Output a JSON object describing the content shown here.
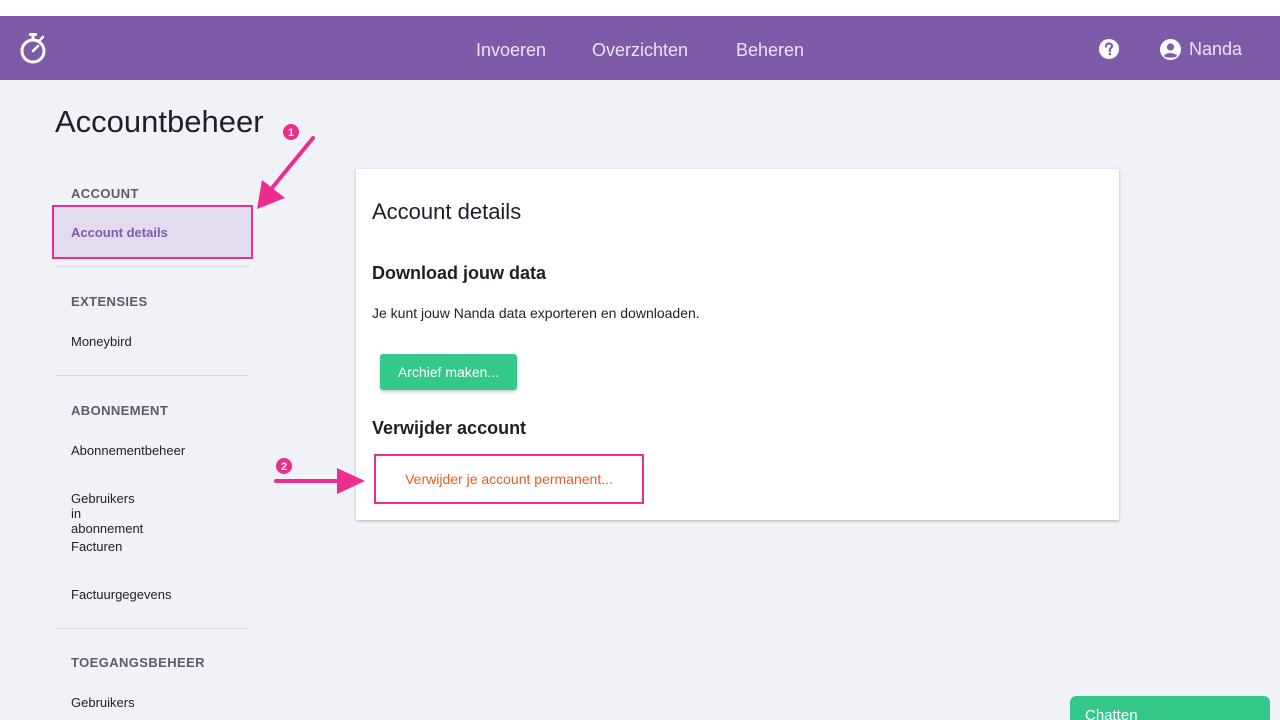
{
  "nav": {
    "links": [
      "Invoeren",
      "Overzichten",
      "Beheren"
    ],
    "user_name": "Nanda"
  },
  "page": {
    "title": "Accountbeheer"
  },
  "sidebar": {
    "sections": [
      {
        "heading": "ACCOUNT",
        "items": [
          "Account details"
        ]
      },
      {
        "heading": "EXTENSIES",
        "items": [
          "Moneybird"
        ]
      },
      {
        "heading": "ABONNEMENT",
        "items": [
          "Abonnementbeheer",
          "Gebruikers in abonnement",
          "Facturen",
          "Factuurgegevens"
        ]
      },
      {
        "heading": "TOEGANGSBEHEER",
        "items": [
          "Gebruikers"
        ]
      }
    ],
    "active_item": "Account details"
  },
  "card": {
    "title": "Account details",
    "download_heading": "Download jouw data",
    "download_text": "Je kunt jouw Nanda data exporteren en downloaden.",
    "archive_button": "Archief maken...",
    "delete_heading": "Verwijder account",
    "delete_button": "Verwijder je account permanent..."
  },
  "annotations": {
    "step1": "1",
    "step2": "2",
    "color": "#ec2d8e"
  },
  "chat": {
    "label": "Chatten"
  },
  "colors": {
    "brand": "#7e5ba8",
    "accent_green": "#34c98b",
    "danger": "#ec5a1e",
    "background": "#f1f2f7"
  },
  "icons": [
    "stopwatch-logo-icon",
    "help-circle-icon",
    "user-circle-icon"
  ]
}
